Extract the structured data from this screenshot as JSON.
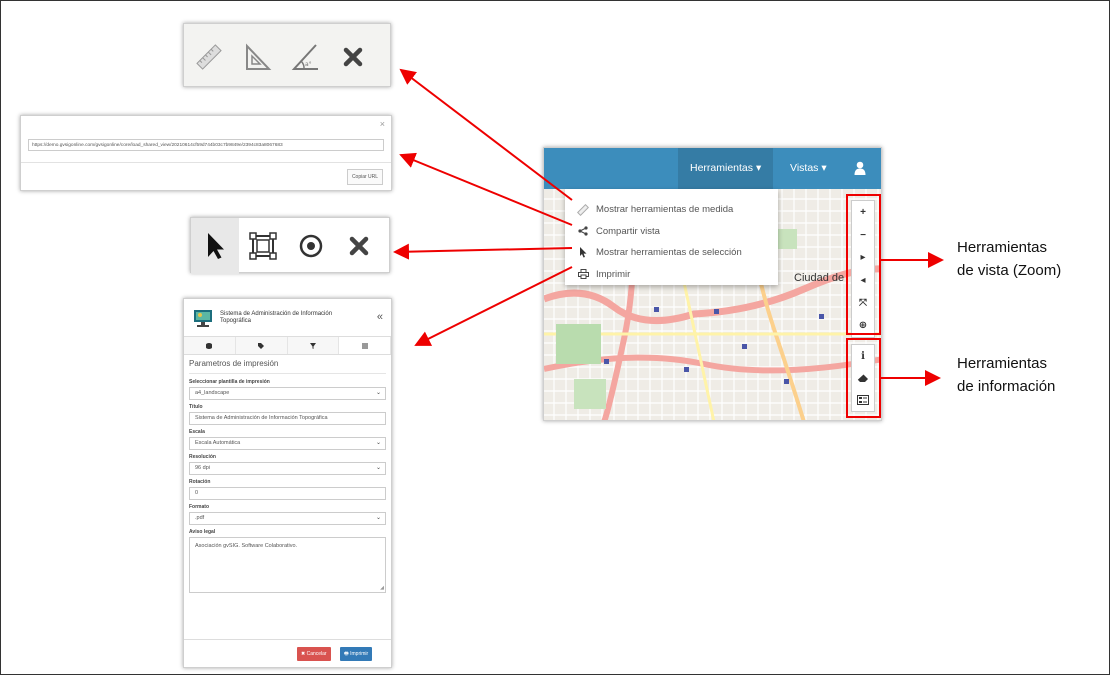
{
  "measure_panel": {
    "top_text": "",
    "tool_icons": [
      "ruler-icon",
      "triangle-ruler-icon",
      "angle-icon",
      "close-icon"
    ]
  },
  "share_panel": {
    "close_label": "×",
    "url": "https://demo.gvsigonline.com/gvsigonline/core/load_shared_view/20210614cf59d744b03c7b9849e/2394c83a8067683",
    "copy_label": "Copiar URL"
  },
  "selection_panel": {
    "tool_icons": [
      "pointer-icon",
      "box-select-icon",
      "circle-select-icon",
      "close-icon"
    ]
  },
  "print_panel": {
    "app_title": "Sistema de Administración de Información Topográfica",
    "collapse_label": "«",
    "section_title": "Parametros de impresión",
    "fields": {
      "template": {
        "label": "Seleccionar plantilla de impresión",
        "value": "a4_landscape"
      },
      "title": {
        "label": "Título",
        "value": "Sistema de Administración de Información Topográfica"
      },
      "scale": {
        "label": "Escala",
        "value": "Escala Automática"
      },
      "resolution": {
        "label": "Resolución",
        "value": "96 dpi"
      },
      "rotation": {
        "label": "Rotación",
        "value": "0"
      },
      "format": {
        "label": "Formato",
        "value": ".pdf"
      },
      "legal": {
        "label": "Aviso legal",
        "value": "Asociación gvSIG. Software Colaborativo."
      }
    },
    "cancel_label": "✖ Cancelar",
    "print_label": "🖶 Imprimir"
  },
  "map": {
    "navbar": {
      "tools_label": "Herramientas ▾",
      "views_label": "Vistas ▾",
      "user_icon": "user-icon"
    },
    "city_label": "Ciudad de",
    "dropdown": [
      {
        "icon": "ruler-icon",
        "label": "Mostrar herramientas de medida"
      },
      {
        "icon": "share-icon",
        "label": "Compartir vista"
      },
      {
        "icon": "pointer-icon",
        "label": "Mostrar herramientas de selección"
      },
      {
        "icon": "print-icon",
        "label": "Imprimir"
      }
    ],
    "zoom_controls": [
      "+",
      "−",
      "▸",
      "◂",
      "⤧",
      "⊕"
    ],
    "info_controls": [
      "i",
      "eraser-icon",
      "legend-icon"
    ]
  },
  "callouts": {
    "zoom_line1": "Herramientas",
    "zoom_line2": "de vista (Zoom)",
    "info_line1": "Herramientas",
    "info_line2": "de información"
  },
  "colors": {
    "navbar": "#3c8dbc",
    "highlight": "#e00000",
    "cancel": "#d9534f",
    "print": "#337ab7"
  }
}
